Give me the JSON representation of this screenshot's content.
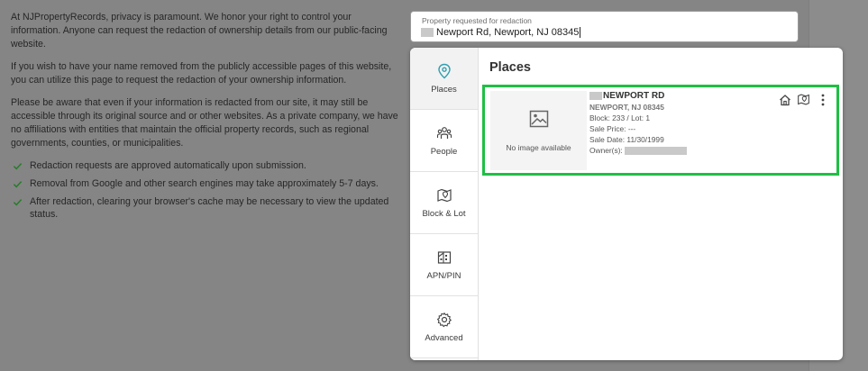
{
  "intro": {
    "paragraphs": [
      "At NJPropertyRecords, privacy is paramount. We honor your right to control your information. Anyone can request the redaction of ownership details from our public-facing website.",
      "If you wish to have your name removed from the publicly accessible pages of this website, you can utilize this page to request the redaction of your ownership information.",
      "Please be aware that even if your information is redacted from our site, it may still be accessible through its original source and or other websites. As a private company, we have no affiliations with entities that maintain the official property records, such as regional governments, counties, or municipalities."
    ],
    "checklist": [
      "Redaction requests are approved automatically upon submission.",
      "Removal from Google and other search engines may take approximately 5-7 days.",
      "After redaction, clearing your browser's cache may be necessary to view the updated status."
    ]
  },
  "search": {
    "label": "Property requested for redaction",
    "value": "Newport Rd, Newport, NJ 08345"
  },
  "tabs": [
    {
      "label": "Places",
      "icon": "map-pin-icon",
      "active": true
    },
    {
      "label": "People",
      "icon": "people-icon",
      "active": false
    },
    {
      "label": "Block & Lot",
      "icon": "map-marker-icon",
      "active": false
    },
    {
      "label": "APN/PIN",
      "icon": "building-icon",
      "active": false
    },
    {
      "label": "Advanced",
      "icon": "gear-icon",
      "active": false
    }
  ],
  "results": {
    "title": "Places",
    "item": {
      "no_image": "No image available",
      "street": "NEWPORT RD",
      "city": "NEWPORT, NJ 08345",
      "block_lot": "Block: 233 / Lot: 1",
      "sale_price": "Sale Price: ---",
      "sale_date": "Sale Date: 11/30/1999",
      "owner_label": "Owner(s):"
    }
  },
  "colors": {
    "accent_highlight": "#1fbf44",
    "tab_icon": "#2f9fb0",
    "check": "#2a7a2e"
  }
}
